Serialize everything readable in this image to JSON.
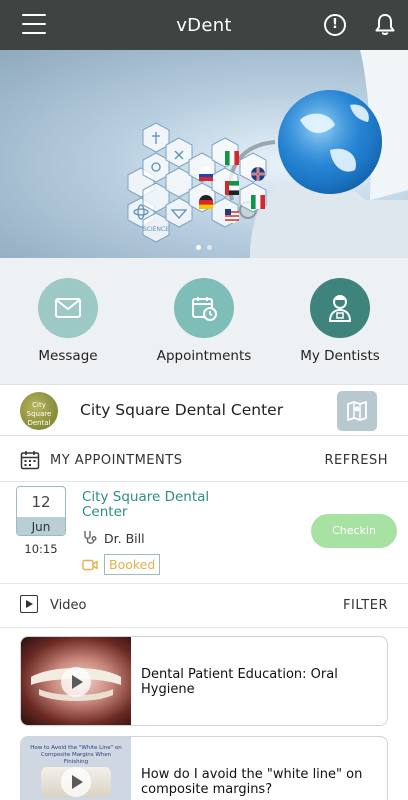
{
  "app": {
    "title": "vDent"
  },
  "quick_actions": [
    {
      "label": "Message",
      "icon": "envelope-icon",
      "color": "#9cc8c6"
    },
    {
      "label": "Appointments",
      "icon": "calendar-clock-icon",
      "color": "#7fbdb8"
    },
    {
      "label": "My Dentists",
      "icon": "dentist-icon",
      "color": "#3f837d"
    }
  ],
  "clinic": {
    "logo_text": "City Square Dental Centre",
    "name": "City Square Dental Center"
  },
  "appointments": {
    "title": "MY APPOINTMENTS",
    "refresh_label": "REFRESH",
    "items": [
      {
        "day": "12",
        "month": "Jun",
        "time": "10:15",
        "clinic_name": "City Square Dental Center",
        "doctor": "Dr. Bill",
        "status": "Booked",
        "action_label": "Checkin"
      }
    ]
  },
  "videos": {
    "title": "Video",
    "filter_label": "FILTER",
    "items": [
      {
        "title": "Dental Patient Education: Oral Hygiene"
      },
      {
        "title": "How do I avoid the \"white line\" on composite margins?",
        "thumb_caption": "How to Avoid the \"White Line\" on Composite Margins When Finishing"
      }
    ]
  },
  "colors": {
    "topbar": "#3d4441",
    "accent_teal": "#2b8f86",
    "checkin_green": "#a8e2a2",
    "booked_orange": "#e5b04f"
  }
}
